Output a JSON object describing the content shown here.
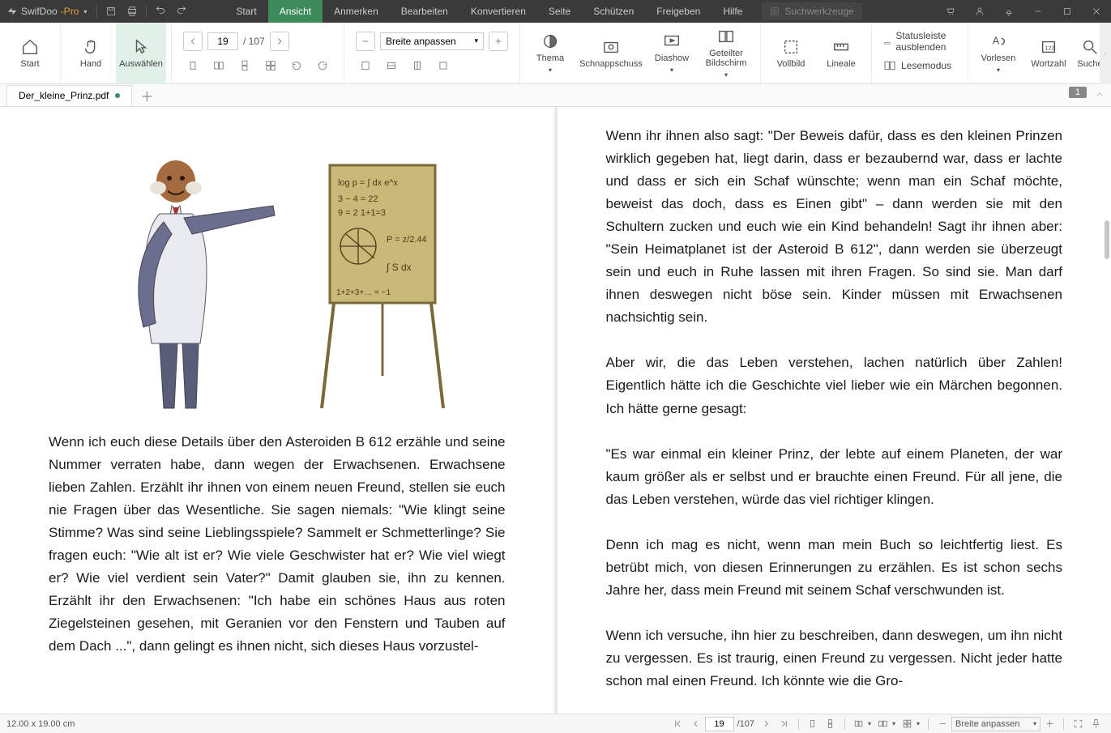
{
  "brand": {
    "name": "SwifDoo",
    "suffix": "-Pro"
  },
  "menus": [
    "Start",
    "Ansicht",
    "Anmerken",
    "Bearbeiten",
    "Konvertieren",
    "Seite",
    "Schützen",
    "Freigeben",
    "Hilfe"
  ],
  "active_menu": 1,
  "search_placeholder": "Suchwerkzeuge",
  "ribbon": {
    "start": "Start",
    "hand": "Hand",
    "select": "Auswählen",
    "page": "19",
    "pages": "/ 107",
    "zoom": "Breite anpassen",
    "theme": "Thema",
    "snapshot": "Schnappschuss",
    "slideshow": "Diashow",
    "split": "Geteilter Bildschirm",
    "fullscreen": "Vollbild",
    "rulers": "Lineale",
    "hide_status": "Statusleiste ausblenden",
    "read_mode": "Lesemodus",
    "speak": "Vorlesen",
    "wordcount": "Wortzahl",
    "search_label": "Suche"
  },
  "tab": {
    "name": "Der_kleine_Prinz.pdf"
  },
  "page_chip": "1",
  "doc": {
    "left_p": "Wenn ich euch diese Details über den Asteroiden B 612 erzähle und seine Nummer verraten habe, dann wegen der Erwachsenen. Erwachsene lieben Zahlen. Erzählt ihr ihnen von einem neuen Freund, stellen sie euch nie Fragen über das Wesentliche. Sie sagen niemals: \"Wie klingt seine Stimme? Was sind seine Lieblingsspiele? Sammelt er Schmetterlinge? Sie fragen euch: \"Wie alt ist er? Wie viele Geschwister hat er? Wie viel wiegt er? Wie viel verdient sein Vater?\" Damit glauben sie, ihn zu kennen. Erzählt ihr den Erwachsenen: \"Ich habe ein schönes Haus aus roten Ziegelsteinen gesehen, mit Geranien vor den Fenstern und Tauben auf dem Dach ...\", dann gelingt es ihnen nicht, sich dieses Haus vorzustel-",
    "right_p1": "Wenn ihr ihnen also sagt: \"Der Beweis dafür, dass es den kleinen Prinzen wirklich gegeben hat, liegt darin, dass er bezaubernd war, dass er lachte und dass er sich ein Schaf wünschte; wenn man ein Schaf möchte, beweist das doch, dass es Einen gibt\" – dann werden sie mit den Schultern zucken und euch wie ein Kind behandeln! Sagt ihr ihnen aber: \"Sein Heimatplanet ist der Asteroid B 612\", dann werden sie überzeugt sein und euch in Ruhe lassen mit ihren Fragen. So sind sie. Man darf ihnen deswegen nicht böse sein. Kinder müssen mit Erwachsenen nachsichtig sein.",
    "right_p2": "Aber wir, die das Leben verstehen, lachen natürlich über Zahlen! Eigentlich hätte ich die Geschichte viel lieber wie ein Märchen begonnen. Ich hätte gerne gesagt:",
    "right_p3": "\"Es war einmal ein kleiner Prinz, der lebte auf einem Planeten, der war kaum größer als er selbst und er brauchte einen Freund. Für all jene, die das Leben verstehen, würde das viel richtiger klingen.",
    "right_p4": "Denn ich mag es nicht, wenn man mein Buch so leichtfertig liest. Es betrübt mich, von diesen Erinnerungen zu erzählen. Es ist schon sechs Jahre her, dass mein Freund mit seinem Schaf verschwunden ist.",
    "right_p5": "Wenn ich versuche, ihn hier zu beschreiben, dann deswegen, um ihn nicht zu vergessen. Es ist traurig, einen Freund zu vergessen. Nicht jeder hatte schon mal einen Freund. Ich könnte wie die Gro-"
  },
  "status": {
    "dims": "12.00 x 19.00 cm",
    "page": "19",
    "pages": "/107",
    "zoom": "Breite anpassen"
  }
}
